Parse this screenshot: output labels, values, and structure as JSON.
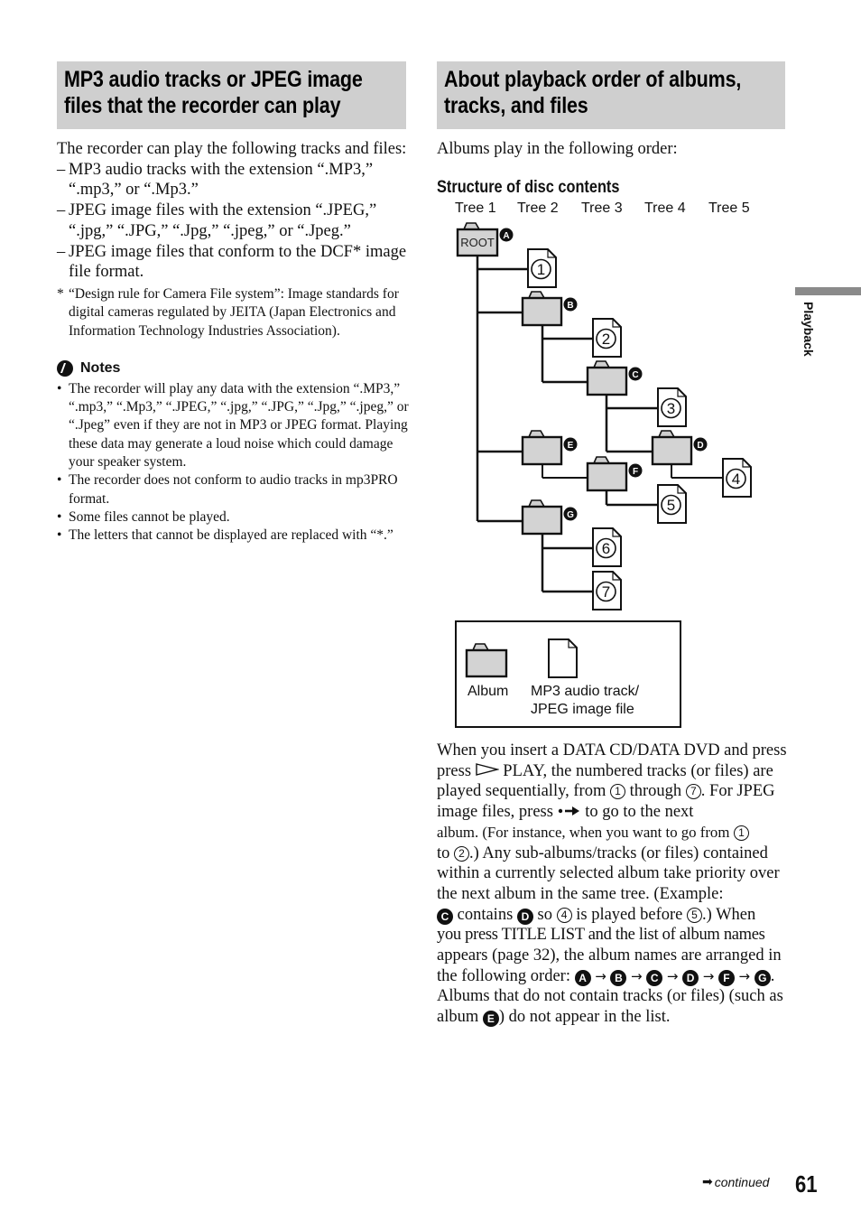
{
  "left_section": {
    "heading": "MP3 audio tracks or JPEG image files that the recorder can play",
    "intro": "The recorder can play the following tracks and files:",
    "list_items": [
      {
        "marker": "–",
        "text": "MP3 audio tracks with the extension “.MP3,” “.mp3,” or “.Mp3.”"
      },
      {
        "marker": "–",
        "text": "JPEG image files with the extension “.JPEG,” “.jpg,” “.JPG,” “.Jpg,” “.jpeg,” or “.Jpeg.”"
      },
      {
        "marker": "–",
        "text": "JPEG image files that conform to the DCF* image file format."
      }
    ],
    "footnote": {
      "marker": "*",
      "text": "“Design rule for Camera File system”: Image standards for digital cameras regulated by JEITA (Japan Electronics and Information Technology Industries Association)."
    },
    "notes": {
      "title": "Notes",
      "icon": "notes-icon",
      "items": [
        "The recorder will play any data with the extension “.MP3,” “.mp3,” “.Mp3,” “.JPEG,” “.jpg,” “.JPG,” “.Jpg,” “.jpeg,” or “.Jpeg” even if they are not in MP3 or JPEG format. Playing these data may generate a loud noise which could damage your speaker system.",
        "The recorder does not conform to audio tracks in mp3PRO format.",
        "Some files cannot be played.",
        "The letters that cannot be displayed are replaced with “*.”"
      ]
    }
  },
  "right_section": {
    "heading": "About playback order of albums, tracks, and files",
    "intro": "Albums play in the following order:",
    "structure_title": "Structure of disc contents",
    "trees": [
      "Tree 1",
      "Tree 2",
      "Tree 3",
      "Tree 4",
      "Tree 5"
    ],
    "diagram": {
      "root_label": "ROOT",
      "albums": [
        "A",
        "B",
        "C",
        "D",
        "E",
        "F",
        "G"
      ],
      "tracks": [
        "1",
        "2",
        "3",
        "4",
        "5",
        "6",
        "7"
      ]
    },
    "legend": {
      "album_label": "Album",
      "file_label_line1": "MP3 audio track/",
      "file_label_line2": "JPEG image file"
    },
    "body": {
      "p1_a": "When you insert a DATA CD/DATA DVD and press",
      "play_icon": "play-icon",
      "p1_b": "PLAY, the numbered tracks (or files) are played sequentially, from",
      "p1_c": "through",
      "p1_d": ". For JPEG image files, press",
      "next_icon": "next-album-icon",
      "p1_e": "to go to the next",
      "p1_small": "album. (For instance, when you want to go from",
      "p1_f": "to",
      "p1_g": ".) Any sub-albums/tracks (or files) contained within a currently selected album take priority over the next album in the same tree. (Example:",
      "p1_h": "contains",
      "p1_i": "so",
      "p1_j": "is played before",
      "p1_k": ".) When",
      "p1_small2": "you press TITLE LIST and the list of album names",
      "p1_l": "appears (page 32), the album names are arranged in the following order:",
      "arrow": "→",
      "p1_m": ". Albums that do not contain tracks (or files) (such as album",
      "p1_n": ") do not appear in the list."
    }
  },
  "side_tab": {
    "label": "Playback"
  },
  "footer": {
    "continued": "continued",
    "page_number": "61"
  }
}
